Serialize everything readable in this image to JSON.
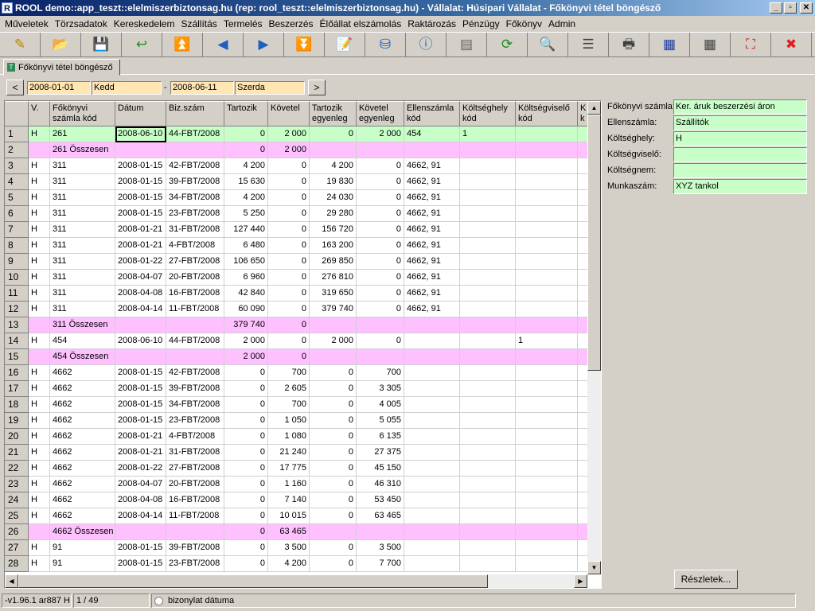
{
  "window": {
    "title": "ROOL demo::app_teszt::elelmiszerbiztonsag.hu (rep: rool_teszt::elelmiszerbiztonsag.hu) - Vállalat: Húsipari Vállalat - Főkönyvi tétel böngésző",
    "app_icon": "app-icon",
    "buttons": [
      "_",
      "▫",
      "✕"
    ]
  },
  "menu": [
    "Műveletek",
    "Törzsadatok",
    "Kereskedelem",
    "Szállítás",
    "Termelés",
    "Beszerzés",
    "Élőállat elszámolás",
    "Raktározás",
    "Pénzügy",
    "Főkönyv",
    "Admin"
  ],
  "toolbar": [
    {
      "name": "edit-icon",
      "glyph": "✎",
      "color": "#c08000"
    },
    {
      "name": "open-folder-icon",
      "glyph": "📂",
      "color": "#1f5fbf"
    },
    {
      "name": "save-disk-icon",
      "glyph": "💾",
      "color": "#1f3f9f"
    },
    {
      "name": "return-arrow-icon",
      "glyph": "↩",
      "color": "#1a8f1a"
    },
    {
      "name": "first-record-icon",
      "glyph": "⏫",
      "color": "#1f5fbf"
    },
    {
      "name": "previous-record-icon",
      "glyph": "◀",
      "color": "#1f5fbf"
    },
    {
      "name": "next-record-icon",
      "glyph": "▶",
      "color": "#1f5fbf"
    },
    {
      "name": "last-record-icon",
      "glyph": "⏬",
      "color": "#1f5fbf"
    },
    {
      "name": "notepad-icon",
      "glyph": "📝",
      "color": "#c08000"
    },
    {
      "name": "database-icon",
      "glyph": "⛁",
      "color": "#1f5fbf"
    },
    {
      "name": "info-icon",
      "glyph": "ⓘ",
      "color": "#1f5fbf"
    },
    {
      "name": "window-layout-icon",
      "glyph": "▤",
      "color": "#5f5f5f"
    },
    {
      "name": "refresh-icon",
      "glyph": "⟳",
      "color": "#1a8f1a"
    },
    {
      "name": "search-icon",
      "glyph": "🔍",
      "color": "#5f5f5f"
    },
    {
      "name": "row-height-icon",
      "glyph": "☰",
      "color": "#404040"
    },
    {
      "name": "print-icon",
      "glyph": "🖶",
      "color": "#404040"
    },
    {
      "name": "table-export-icon",
      "glyph": "▦",
      "color": "#1f3f9f"
    },
    {
      "name": "table-columns-icon",
      "glyph": "▦",
      "color": "#404040"
    },
    {
      "name": "fullscreen-icon",
      "glyph": "⛶",
      "color": "#c02020"
    },
    {
      "name": "close-icon",
      "glyph": "✖",
      "color": "#e02020"
    }
  ],
  "tab": {
    "label": "Főkönyvi tétel böngésző",
    "icon": "T"
  },
  "datebar": {
    "prev": "<",
    "next": ">",
    "from_date": "2008-01-01",
    "from_day": "Kedd",
    "separator": "-",
    "to_date": "2008-06-11",
    "to_day": "Szerda"
  },
  "grid": {
    "columns": [
      {
        "label": "",
        "w": 30
      },
      {
        "label": "V.",
        "w": 27
      },
      {
        "label": "Főkönyvi\nszámla kód",
        "w": 82
      },
      {
        "label": "Dátum",
        "w": 64
      },
      {
        "label": "Biz.szám",
        "w": 73
      },
      {
        "label": "Tartozik",
        "w": 55
      },
      {
        "label": "Követel",
        "w": 52
      },
      {
        "label": "Tartozik\negyenleg",
        "w": 59
      },
      {
        "label": "Követel\negyenleg",
        "w": 60
      },
      {
        "label": "Ellenszámla\nkód",
        "w": 70
      },
      {
        "label": "Költséghely\nkód",
        "w": 70
      },
      {
        "label": "Költségviselő\nkód",
        "w": 78
      },
      {
        "label": "K\nk",
        "w": 20
      }
    ],
    "rows": [
      {
        "t": "sel",
        "c": [
          "1",
          "H",
          "261",
          "2008-06-10",
          "44-FBT/2008",
          "0",
          "2 000",
          "0",
          "2 000",
          "454",
          "1",
          "",
          ""
        ]
      },
      {
        "t": "pink",
        "c": [
          "2",
          "",
          "261 Összesen",
          "",
          "",
          "0",
          "2 000",
          "",
          "",
          "",
          "",
          "",
          ""
        ]
      },
      {
        "t": "",
        "c": [
          "3",
          "H",
          "311",
          "2008-01-15",
          "42-FBT/2008",
          "4 200",
          "0",
          "4 200",
          "0",
          "4662, 91",
          "",
          "",
          ""
        ]
      },
      {
        "t": "",
        "c": [
          "4",
          "H",
          "311",
          "2008-01-15",
          "39-FBT/2008",
          "15 630",
          "0",
          "19 830",
          "0",
          "4662, 91",
          "",
          "",
          ""
        ]
      },
      {
        "t": "",
        "c": [
          "5",
          "H",
          "311",
          "2008-01-15",
          "34-FBT/2008",
          "4 200",
          "0",
          "24 030",
          "0",
          "4662, 91",
          "",
          "",
          ""
        ]
      },
      {
        "t": "",
        "c": [
          "6",
          "H",
          "311",
          "2008-01-15",
          "23-FBT/2008",
          "5 250",
          "0",
          "29 280",
          "0",
          "4662, 91",
          "",
          "",
          ""
        ]
      },
      {
        "t": "",
        "c": [
          "7",
          "H",
          "311",
          "2008-01-21",
          "31-FBT/2008",
          "127 440",
          "0",
          "156 720",
          "0",
          "4662, 91",
          "",
          "",
          ""
        ]
      },
      {
        "t": "",
        "c": [
          "8",
          "H",
          "311",
          "2008-01-21",
          "4-FBT/2008",
          "6 480",
          "0",
          "163 200",
          "0",
          "4662, 91",
          "",
          "",
          ""
        ]
      },
      {
        "t": "",
        "c": [
          "9",
          "H",
          "311",
          "2008-01-22",
          "27-FBT/2008",
          "106 650",
          "0",
          "269 850",
          "0",
          "4662, 91",
          "",
          "",
          ""
        ]
      },
      {
        "t": "",
        "c": [
          "10",
          "H",
          "311",
          "2008-04-07",
          "20-FBT/2008",
          "6 960",
          "0",
          "276 810",
          "0",
          "4662, 91",
          "",
          "",
          ""
        ]
      },
      {
        "t": "",
        "c": [
          "11",
          "H",
          "311",
          "2008-04-08",
          "16-FBT/2008",
          "42 840",
          "0",
          "319 650",
          "0",
          "4662, 91",
          "",
          "",
          ""
        ]
      },
      {
        "t": "",
        "c": [
          "12",
          "H",
          "311",
          "2008-04-14",
          "11-FBT/2008",
          "60 090",
          "0",
          "379 740",
          "0",
          "4662, 91",
          "",
          "",
          ""
        ]
      },
      {
        "t": "pink",
        "c": [
          "13",
          "",
          "311 Összesen",
          "",
          "",
          "379 740",
          "0",
          "",
          "",
          "",
          "",
          "",
          ""
        ]
      },
      {
        "t": "",
        "c": [
          "14",
          "H",
          "454",
          "2008-06-10",
          "44-FBT/2008",
          "2 000",
          "0",
          "2 000",
          "0",
          "",
          "",
          "1",
          ""
        ]
      },
      {
        "t": "pink",
        "c": [
          "15",
          "",
          "454 Összesen",
          "",
          "",
          "2 000",
          "0",
          "",
          "",
          "",
          "",
          "",
          ""
        ]
      },
      {
        "t": "",
        "c": [
          "16",
          "H",
          "4662",
          "2008-01-15",
          "42-FBT/2008",
          "0",
          "700",
          "0",
          "700",
          "",
          "",
          "",
          ""
        ]
      },
      {
        "t": "",
        "c": [
          "17",
          "H",
          "4662",
          "2008-01-15",
          "39-FBT/2008",
          "0",
          "2 605",
          "0",
          "3 305",
          "",
          "",
          "",
          ""
        ]
      },
      {
        "t": "",
        "c": [
          "18",
          "H",
          "4662",
          "2008-01-15",
          "34-FBT/2008",
          "0",
          "700",
          "0",
          "4 005",
          "",
          "",
          "",
          ""
        ]
      },
      {
        "t": "",
        "c": [
          "19",
          "H",
          "4662",
          "2008-01-15",
          "23-FBT/2008",
          "0",
          "1 050",
          "0",
          "5 055",
          "",
          "",
          "",
          ""
        ]
      },
      {
        "t": "",
        "c": [
          "20",
          "H",
          "4662",
          "2008-01-21",
          "4-FBT/2008",
          "0",
          "1 080",
          "0",
          "6 135",
          "",
          "",
          "",
          ""
        ]
      },
      {
        "t": "",
        "c": [
          "21",
          "H",
          "4662",
          "2008-01-21",
          "31-FBT/2008",
          "0",
          "21 240",
          "0",
          "27 375",
          "",
          "",
          "",
          ""
        ]
      },
      {
        "t": "",
        "c": [
          "22",
          "H",
          "4662",
          "2008-01-22",
          "27-FBT/2008",
          "0",
          "17 775",
          "0",
          "45 150",
          "",
          "",
          "",
          ""
        ]
      },
      {
        "t": "",
        "c": [
          "23",
          "H",
          "4662",
          "2008-04-07",
          "20-FBT/2008",
          "0",
          "1 160",
          "0",
          "46 310",
          "",
          "",
          "",
          ""
        ]
      },
      {
        "t": "",
        "c": [
          "24",
          "H",
          "4662",
          "2008-04-08",
          "16-FBT/2008",
          "0",
          "7 140",
          "0",
          "53 450",
          "",
          "",
          "",
          ""
        ]
      },
      {
        "t": "",
        "c": [
          "25",
          "H",
          "4662",
          "2008-04-14",
          "11-FBT/2008",
          "0",
          "10 015",
          "0",
          "63 465",
          "",
          "",
          "",
          ""
        ]
      },
      {
        "t": "pink",
        "c": [
          "26",
          "",
          "4662 Összesen",
          "",
          "",
          "0",
          "63 465",
          "",
          "",
          "",
          "",
          "",
          ""
        ]
      },
      {
        "t": "",
        "c": [
          "27",
          "H",
          "91",
          "2008-01-15",
          "39-FBT/2008",
          "0",
          "3 500",
          "0",
          "3 500",
          "",
          "",
          "",
          ""
        ]
      },
      {
        "t": "",
        "c": [
          "28",
          "H",
          "91",
          "2008-01-15",
          "23-FBT/2008",
          "0",
          "4 200",
          "0",
          "7 700",
          "",
          "",
          "",
          ""
        ]
      }
    ]
  },
  "details": [
    {
      "label": "Főkönyvi számla:",
      "value": "Ker. áruk beszerzési áron"
    },
    {
      "label": "Ellenszámla:",
      "value": "Szállítók"
    },
    {
      "label": "Költséghely:",
      "value": "H"
    },
    {
      "label": "Költségviselő:",
      "value": ""
    },
    {
      "label": "Költségnem:",
      "value": ""
    },
    {
      "label": "Munkaszám:",
      "value": "XYZ tankol"
    }
  ],
  "details_button": "Részletek...",
  "status": {
    "version": "-v1.96.1 ar887 H",
    "position": "1 / 49",
    "sort": "bizonylat dátuma"
  },
  "colors": {
    "selected_row": "#c8ffc8",
    "subtotal_row": "#ffc0ff",
    "date_field": "#ffe6b3",
    "detail_field": "#c8ffc8"
  }
}
